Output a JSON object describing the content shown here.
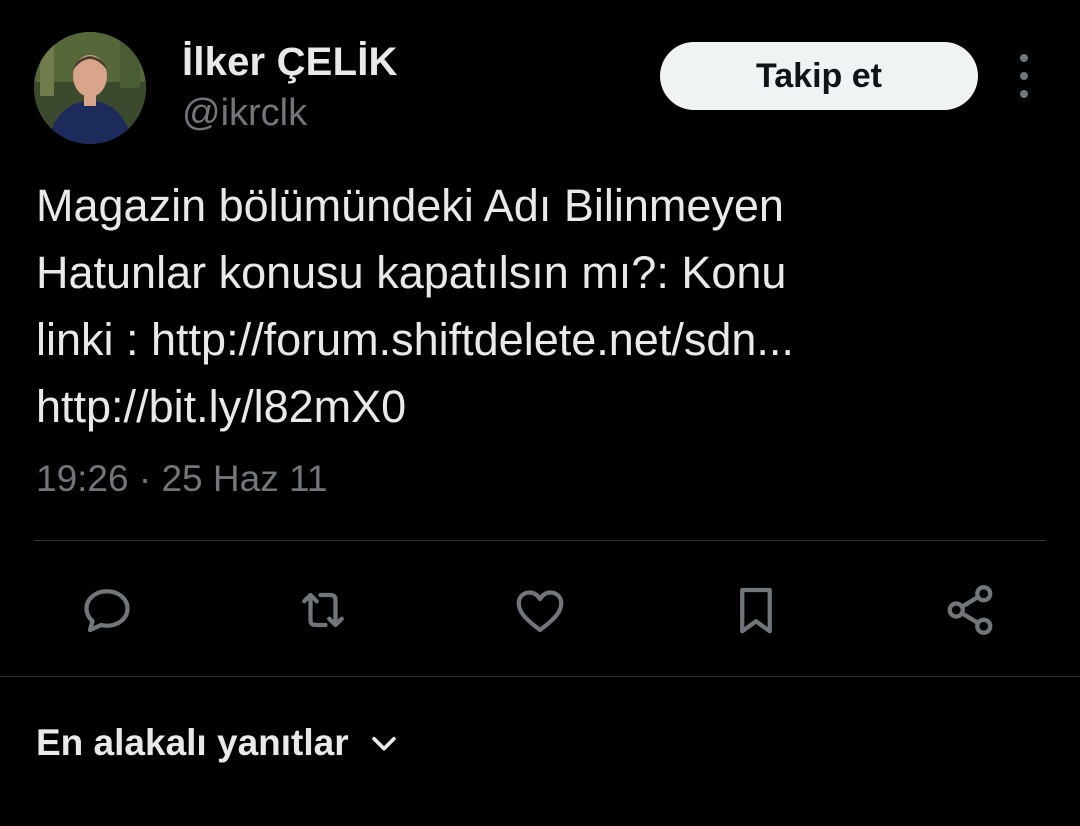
{
  "author": {
    "display_name": "İlker ÇELİK",
    "handle": "@ikrclk",
    "avatar_icon": "profile-photo"
  },
  "follow_button": {
    "label": "Takip et"
  },
  "more_menu": {
    "icon": "more-vertical-icon"
  },
  "tweet": {
    "text_lines": [
      "Magazin bölümündeki Adı Bilinmeyen",
      "Hatunlar konusu kapatılsın mı?: Konu",
      "linki : http://forum.shiftdelete.net/sdn...",
      "http://bit.ly/l82mX0"
    ],
    "time": "19:26",
    "separator": "·",
    "date": "25 Haz 11"
  },
  "actions": [
    {
      "name": "reply",
      "icon": "reply-icon"
    },
    {
      "name": "retweet",
      "icon": "retweet-icon"
    },
    {
      "name": "like",
      "icon": "heart-icon"
    },
    {
      "name": "bookmark",
      "icon": "bookmark-icon"
    },
    {
      "name": "share",
      "icon": "share-icon"
    }
  ],
  "replies_sort": {
    "label": "En alakalı yanıtlar",
    "icon": "chevron-down-icon"
  },
  "colors": {
    "background": "#000000",
    "text_primary": "#e7e9ea",
    "text_secondary": "#71767b",
    "divider": "#2f3336",
    "button_bg": "#eff3f4"
  }
}
